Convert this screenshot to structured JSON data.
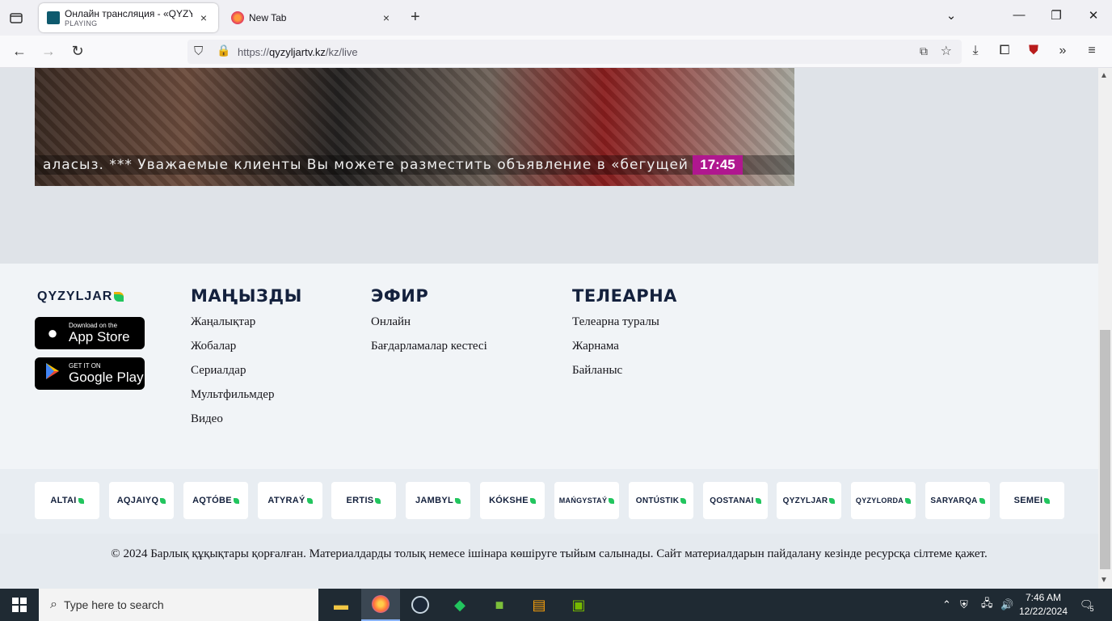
{
  "browser": {
    "tabs": [
      {
        "title": "Онлайн трансляция - «QYZYL",
        "status": "PLAYING",
        "close": "×"
      },
      {
        "title": "New Tab",
        "close": "×"
      }
    ],
    "new_tab": "+",
    "url_prefix": "https://",
    "url_host": "qyzyljartv.kz",
    "url_path": "/kz/live"
  },
  "video": {
    "ticker": "аласыз.   *** Уважаемые клиенты Вы можете разместить объявление в «бегущей с",
    "time": "17:45"
  },
  "footer": {
    "logo": "QYZYLJAR",
    "app_store": {
      "small": "Download on the",
      "big": "App Store"
    },
    "google_play": {
      "small": "GET IT ON",
      "big": "Google Play"
    },
    "columns": [
      {
        "title": "МАҢЫЗДЫ",
        "links": [
          "Жаңалықтар",
          "Жобалар",
          "Сериалдар",
          "Мультфильмдер",
          "Видео"
        ]
      },
      {
        "title": "ЭФИР",
        "links": [
          "Онлайн",
          "Бағдарламалар кестесі"
        ]
      },
      {
        "title": "ТЕЛЕАРНА",
        "links": [
          "Телеарна туралы",
          "Жарнама",
          "Байланыс"
        ]
      }
    ],
    "regions": [
      "ALTAI",
      "AQJAIYQ",
      "AQTÓBE",
      "ATYRAÝ",
      "ERTIS",
      "JAMBYL",
      "KÓKSHE",
      "MAŃGYSTAÝ",
      "ONTÚSTIK",
      "QOSTANAI",
      "QYZYLJAR",
      "QYZYLORDA",
      "SARYARQA",
      "SEMEI"
    ],
    "copyright": "© 2024 Барлық құқықтары қорғалған. Материалдарды толық немесе ішінара көшіруге тыйым салынады. Сайт материалдарын пайдалану кезінде ресурсқа сілтеме қажет."
  },
  "taskbar": {
    "search_placeholder": "Type here to search",
    "time": "7:46 AM",
    "date": "12/22/2024",
    "notification_count": "5"
  }
}
